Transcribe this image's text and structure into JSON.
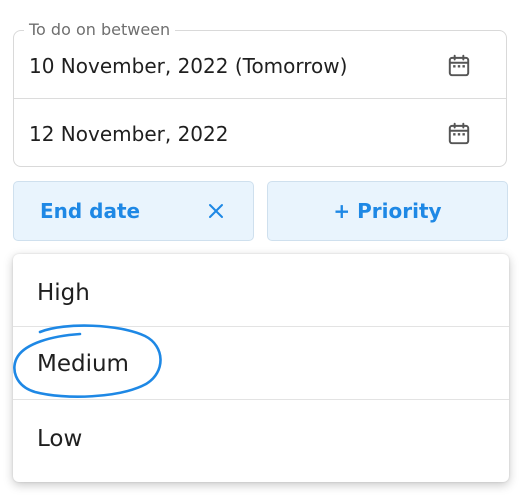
{
  "date_filter": {
    "legend": "To do on between",
    "start_date": "10 November, 2022 (Tomorrow)",
    "end_date": "12 November, 2022",
    "icon": "calendar-icon"
  },
  "chips": {
    "end_date_label": "End date",
    "priority_label": "+ Priority"
  },
  "priority_menu": {
    "options": [
      "High",
      "Medium",
      "Low"
    ],
    "highlighted": "Medium"
  },
  "colors": {
    "accent": "#1e88e5",
    "chip_background": "#e9f4fd",
    "annotation": "#1e88e5"
  }
}
